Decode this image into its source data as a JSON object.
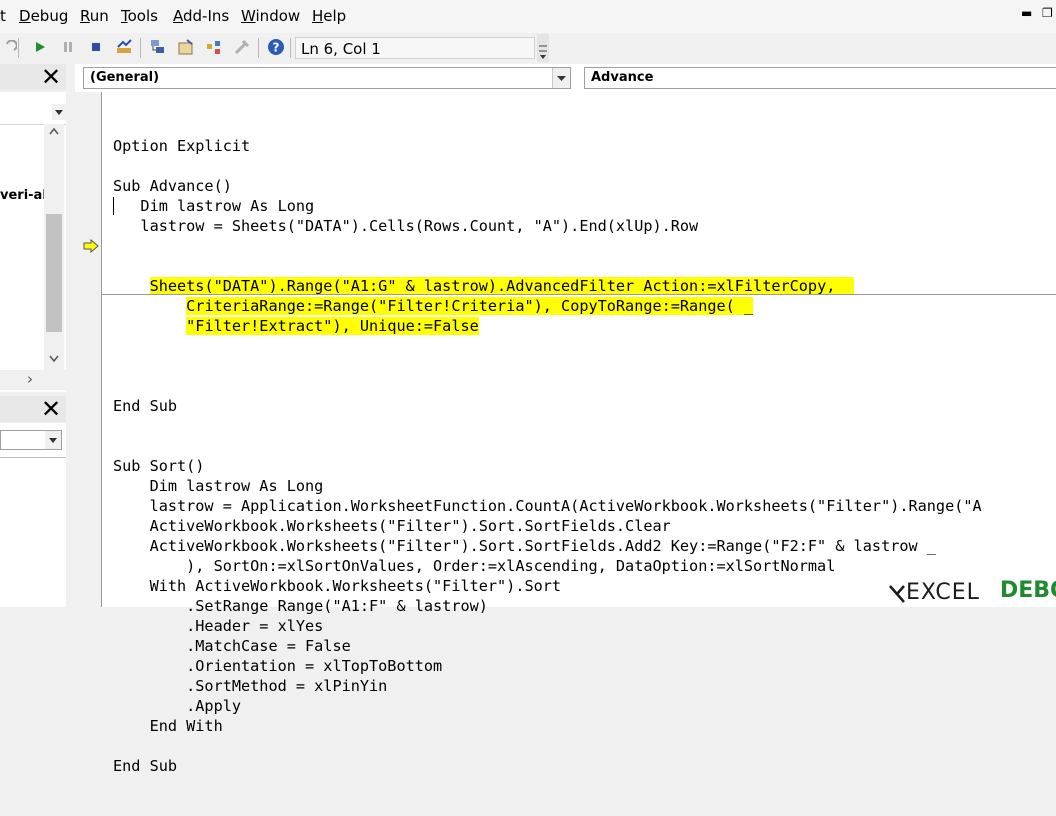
{
  "menubar": {
    "items": [
      {
        "pre": "",
        "u": "D",
        "post": "ebug"
      },
      {
        "pre": "",
        "u": "R",
        "post": "un"
      },
      {
        "pre": "",
        "u": "T",
        "post": "ools"
      },
      {
        "pre": "",
        "u": "A",
        "post": "dd-Ins"
      },
      {
        "pre": "",
        "u": "W",
        "post": "indow"
      },
      {
        "pre": "",
        "u": "H",
        "post": "elp"
      }
    ],
    "partial_left": "t"
  },
  "toolbar": {
    "cursor_position": "Ln 6, Col 1",
    "icons": [
      "undo-icon",
      "run-icon",
      "break-icon",
      "reset-icon",
      "design-mode-icon",
      "project-explorer-icon",
      "properties-window-icon",
      "object-browser-icon",
      "toolbox-icon",
      "help-icon"
    ]
  },
  "left_panel": {
    "project_item_partial": "veri-al",
    "scroll_arrow": "›"
  },
  "code_window": {
    "object_combo": "(General)",
    "procedure_combo": "Advance",
    "block1": [
      "Option Explicit",
      "",
      "Sub Advance()",
      "   Dim lastrow As Long",
      "   lastrow = Sheets(\"DATA\").Cells(Rows.Count, \"A\").End(xlUp).Row"
    ],
    "block1_highlight": [
      "    Sheets(\"DATA\").Range(\"A1:G\" & lastrow).AdvancedFilter Action:=xlFilterCopy, _",
      "        CriteriaRange:=Range(\"Filter!Criteria\"), CopyToRange:=Range( _",
      "        \"Filter!Extract\"), Unique:=False"
    ],
    "block1_tail": [
      "",
      "End Sub"
    ],
    "block2": [
      "Sub Sort()",
      "    Dim lastrow As Long",
      "    lastrow = Application.WorksheetFunction.CountA(ActiveWorkbook.Worksheets(\"Filter\").Range(\"A",
      "    ActiveWorkbook.Worksheets(\"Filter\").Sort.SortFields.Clear",
      "    ActiveWorkbook.Worksheets(\"Filter\").Sort.SortFields.Add2 Key:=Range(\"F2:F\" & lastrow _",
      "        ), SortOn:=xlSortOnValues, Order:=xlAscending, DataOption:=xlSortNormal",
      "    With ActiveWorkbook.Worksheets(\"Filter\").Sort",
      "        .SetRange Range(\"A1:F\" & lastrow)",
      "        .Header = xlYes",
      "        .MatchCase = False",
      "        .Orientation = xlTopToBottom",
      "        .SortMethod = xlPinYin",
      "        .Apply",
      "    End With",
      "",
      "End Sub"
    ]
  },
  "watermark": {
    "brand": "EXCEL",
    "brand_suffix": "DEBO"
  },
  "colors": {
    "highlight": "#ffff00",
    "execution_arrow": "#ffff00"
  }
}
